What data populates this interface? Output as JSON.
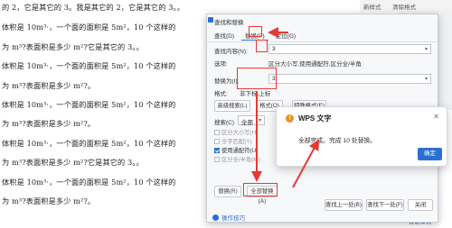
{
  "document": {
    "lines": [
      "的 2，它是其它的 3。我是其它的 2，它是其它的 3。。",
      "体积是 10m³·，一个面的面积是 5m²，10 个这样的",
      "为 m³?表面积是多少 m²?它是其它的 3。。",
      "体积是 10m³·，一个面的面积是 5m²，10 个这样的",
      "为 m³?表面积是多少 m²?。",
      "体积是 10m³·，一个面的面积是 5m²，10 个这样的",
      "为 m³?表面积是多少 m²?。",
      "体积是 10m³·，一个面的面积是 5m²，10 个这样的",
      "为 m³?表面积是多少 m²?它是其它的 3。。",
      "体积是 10m³·，一个面的面积是 5m²，10 个这样的",
      "为 m³?表面积是多少 m²?。"
    ]
  },
  "toolbar": {
    "item1": "新样式",
    "item2": "清除格式"
  },
  "dialog": {
    "title": "查找和替换",
    "tabs": [
      "查找(D)",
      "替换(P)",
      "定位(G)"
    ],
    "find_label": "查找内容(N):",
    "find_value": "3",
    "options_label": "选项:",
    "options_value": "区分大小写,使用通配符,区分全/半角",
    "replace_label": "替换为(I):",
    "replace_value": "3",
    "format_label": "格式:",
    "format_value": "非下标,上标",
    "advanced_button": "高级搜索(L)",
    "format_button": "格式(O)",
    "special_button": "特殊格式(E)",
    "search_label": "搜索(C)",
    "search_value": "全部",
    "checkboxes": [
      {
        "label": "区分大小写(H)",
        "checked": false
      },
      {
        "label": "全字匹配(Y)",
        "checked": false
      },
      {
        "label": "使用通配符(U)",
        "checked": true
      },
      {
        "label": "区分全/半角(M)",
        "checked": false
      }
    ],
    "replace_button": "替换(R)",
    "replace_all_button": "全部替换(A)",
    "find_prev_button": "查找上一处(B)",
    "find_next_button": "查找下一处(F)",
    "close_button": "关闭",
    "tips_link": "操作技巧"
  },
  "popup": {
    "title": "WPS 文字",
    "message": "全部完成。完成 10 处替换。",
    "ok_button": "确定"
  },
  "bottom_right": {
    "label1": "前缀",
    "label2": "后缀",
    "label3": "智能样式"
  },
  "colors": {
    "accent": "#2a6fd6",
    "annotation": "#e53935",
    "warning": "#e8912a"
  }
}
